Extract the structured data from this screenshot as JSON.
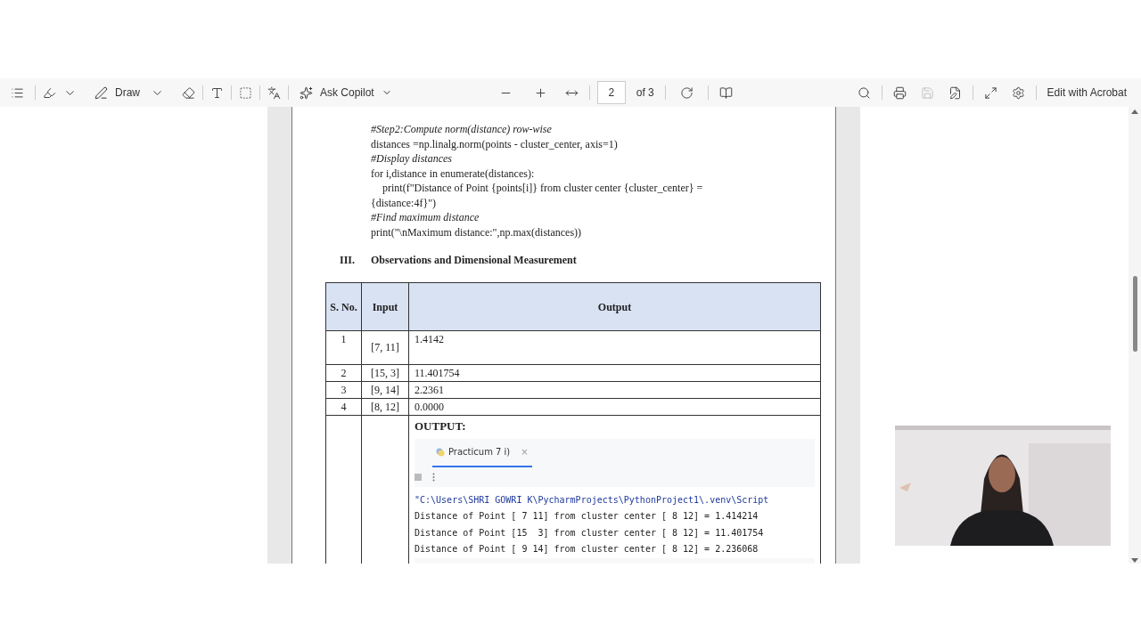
{
  "toolbar": {
    "draw_label": "Draw",
    "copilot_label": "Ask Copilot",
    "page": "2",
    "page_total": "of 3",
    "save_disabled": true,
    "edit_label": "Edit with Acrobat"
  },
  "document": {
    "code_lines": [
      {
        "kind": "comment",
        "text": "#Step2:Compute norm(distance) row-wise",
        "indent": false
      },
      {
        "kind": "code",
        "text": "distances =np.linalg.norm(points - cluster_center, axis=1)",
        "indent": false
      },
      {
        "kind": "comment",
        "text": "#Display distances",
        "indent": false
      },
      {
        "kind": "code",
        "text": "for i,distance in enumerate(distances):",
        "indent": false
      },
      {
        "kind": "code",
        "text": "print(f\"Distance of Point {points[i]} from cluster center {cluster_center} =",
        "indent": true
      },
      {
        "kind": "code",
        "text": "{distance:4f}\")",
        "indent": false
      },
      {
        "kind": "comment",
        "text": "#Find maximum distance",
        "indent": false
      },
      {
        "kind": "code",
        "text": "print(\"\\nMaximum distance:\",np.max(distances))",
        "indent": false
      }
    ],
    "section": {
      "number": "III.",
      "title": "Observations and Dimensional Measurement"
    },
    "table": {
      "columns": [
        "S. No.",
        "Input",
        "Output"
      ],
      "rows": [
        {
          "s_no": "1",
          "input": "[7, 11]",
          "output": "1.4142"
        },
        {
          "s_no": "2",
          "input": "[15, 3]",
          "output": "11.401754"
        },
        {
          "s_no": "3",
          "input": "[9, 14]",
          "output": "2.2361"
        },
        {
          "s_no": "4",
          "input": "[8, 12]",
          "output": "0.0000"
        }
      ],
      "output_block": {
        "heading": "OUTPUT:",
        "tab_label": "Practicum 7 i)",
        "close": "×",
        "console_lines": [
          "\"C:\\Users\\SHRI GOWRI K\\PycharmProjects\\PythonProject1\\.venv\\Script",
          "Distance of Point [ 7 11] from cluster center [ 8 12] = 1.414214",
          "Distance of Point [15  3] from cluster center [ 8 12] = 11.401754",
          "Distance of Point [ 9 14] from cluster center [ 8 12] = 2.236068"
        ]
      }
    }
  }
}
